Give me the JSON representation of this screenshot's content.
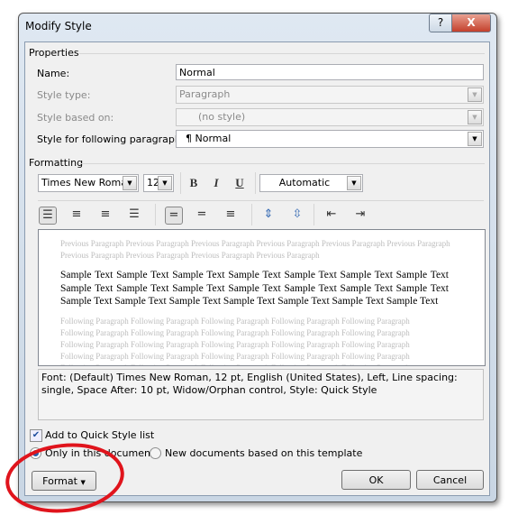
{
  "window": {
    "title": "Modify Style",
    "help_label": "?",
    "close_label": "X"
  },
  "properties": {
    "section_label": "Properties",
    "name_label": "Name:",
    "name_value": "Normal",
    "style_type_label": "Style type:",
    "style_type_value": "Paragraph",
    "based_on_label": "Style based on:",
    "based_on_value": "(no style)",
    "following_label": "Style for following paragraph:",
    "following_value": "¶ Normal"
  },
  "formatting": {
    "section_label": "Formatting",
    "font": "Times New Roman",
    "size": "12",
    "bold": "B",
    "italic": "I",
    "underline": "U",
    "color": "Automatic",
    "align_icons": [
      "align-left-icon",
      "align-center-icon",
      "align-right-icon",
      "justify-icon"
    ],
    "spacing_icons": [
      "single-spacing-icon",
      "one-half-spacing-icon",
      "double-spacing-icon"
    ],
    "para_icons": [
      "increase-space-before-icon",
      "decrease-space-before-icon",
      "decrease-indent-icon",
      "increase-indent-icon"
    ]
  },
  "preview": {
    "previous": "Previous Paragraph Previous Paragraph Previous Paragraph Previous Paragraph Previous Paragraph Previous Paragraph Previous Paragraph Previous Paragraph Previous Paragraph Previous Paragraph",
    "sample": "Sample Text Sample Text Sample Text Sample Text Sample Text Sample Text Sample Text Sample Text Sample Text Sample Text Sample Text Sample Text Sample Text Sample Text Sample Text Sample Text Sample Text Sample Text Sample Text Sample Text Sample Text",
    "following": "Following Paragraph Following Paragraph Following Paragraph Following Paragraph Following Paragraph Following Paragraph Following Paragraph Following Paragraph Following Paragraph Following Paragraph Following Paragraph Following Paragraph Following Paragraph Following Paragraph Following Paragraph Following Paragraph Following Paragraph Following Paragraph Following Paragraph Following Paragraph Following Paragraph Following Paragraph Following Paragraph Following Paragraph Following Paragraph"
  },
  "description": "Font: (Default) Times New Roman, 12 pt, English (United States), Left, Line spacing:  single, Space After:  10 pt, Widow/Orphan control, Style: Quick Style",
  "options": {
    "quick_style_label": "Add to Quick Style list",
    "quick_style_checked": true,
    "only_doc_label": "Only in this document",
    "new_docs_label": "New documents based on this template",
    "selected": "only_doc"
  },
  "buttons": {
    "format": "Format",
    "ok": "OK",
    "cancel": "Cancel"
  },
  "annotation": {
    "color": "#e0141c"
  }
}
